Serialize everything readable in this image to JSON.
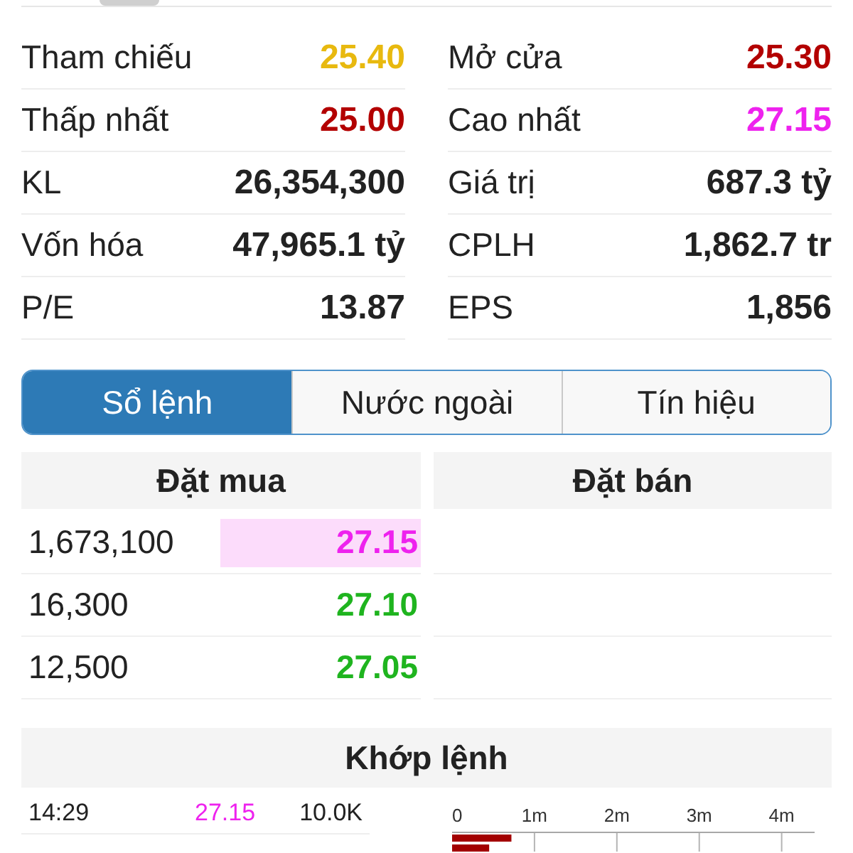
{
  "stats": [
    {
      "label": "Tham chiếu",
      "value": "25.40",
      "color": "#e8b90f"
    },
    {
      "label": "Mở cửa",
      "value": "25.30",
      "color": "#b30000"
    },
    {
      "label": "Thấp nhất",
      "value": "25.00",
      "color": "#b30000"
    },
    {
      "label": "Cao nhất",
      "value": "27.15",
      "color": "#ee22ee"
    },
    {
      "label": "KL",
      "value": "26,354,300",
      "color": "#222222"
    },
    {
      "label": "Giá trị",
      "value": "687.3 tỷ",
      "color": "#222222"
    },
    {
      "label": "Vốn hóa",
      "value": "47,965.1 tỷ",
      "color": "#222222"
    },
    {
      "label": "CPLH",
      "value": "1,862.7 tr",
      "color": "#222222"
    },
    {
      "label": "P/E",
      "value": "13.87",
      "color": "#222222"
    },
    {
      "label": "EPS",
      "value": "1,856",
      "color": "#222222"
    }
  ],
  "tabs": [
    {
      "label": "Sổ lệnh",
      "selected": true
    },
    {
      "label": "Nước ngoài",
      "selected": false
    },
    {
      "label": "Tín hiệu",
      "selected": false
    }
  ],
  "order_book": {
    "columns": [
      "Đặt mua",
      "Đặt bán"
    ],
    "bids": [
      {
        "volume": "1,673,100",
        "price": "27.15",
        "color": "#ee22ee",
        "highlighted": true
      },
      {
        "volume": "16,300",
        "price": "27.10",
        "color": "#1fb41f",
        "highlighted": false
      },
      {
        "volume": "12,500",
        "price": "27.05",
        "color": "#1fb41f",
        "highlighted": false
      }
    ]
  },
  "matched": {
    "title": "Khớp lệnh",
    "trades": [
      {
        "time": "14:29",
        "price": "27.15",
        "color": "#ee22ee",
        "volume": "10.0K"
      }
    ],
    "chart_data": {
      "type": "bar",
      "orientation": "horizontal",
      "xlim": [
        0,
        4400000
      ],
      "xticks": [
        {
          "value": 0,
          "label": "0"
        },
        {
          "value": 1000000,
          "label": "1m"
        },
        {
          "value": 2000000,
          "label": "2m"
        },
        {
          "value": 3000000,
          "label": "3m"
        },
        {
          "value": 4000000,
          "label": "4m"
        }
      ],
      "series": [
        {
          "color": "#a30000",
          "values": [
            720000,
            450000
          ]
        }
      ]
    }
  }
}
